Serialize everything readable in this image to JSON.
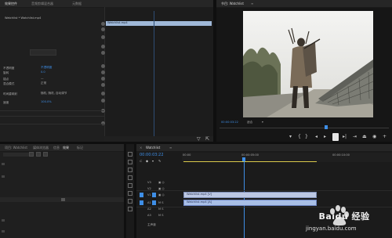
{
  "effect_controls": {
    "tabs": [
      "效果控件",
      "音频剪辑混合器",
      "元数据"
    ],
    "clip_title": "Watchlist * Watchlist.mp4",
    "seq_label": "Watchlist.mp4",
    "rows": [
      {
        "label": "不透明度",
        "value": "不透明度"
      },
      {
        "label": "旋转",
        "value": "0.0"
      },
      {
        "label": "锚点",
        "value": "—"
      },
      {
        "label": "混合模式",
        "value": "正常"
      },
      {
        "label": "时间重映射",
        "value": "随机, 随机, 自动调节"
      },
      {
        "label": "速度",
        "value": "100.0%"
      }
    ]
  },
  "program_monitor": {
    "tab_label": "节目: Watchlist",
    "timecode": "00:00:03:22",
    "fit_label": "适合"
  },
  "project": {
    "tabs": [
      "项目: Watchlist",
      "媒体浏览器",
      "信息",
      "效果",
      "标记"
    ]
  },
  "timeline": {
    "tab_label": "Watchlist",
    "timecode": "00:00:03:22",
    "ruler_labels": [
      "00:00",
      "00:00:05:00",
      "00:00:10:00"
    ],
    "tracks": [
      "V3",
      "V2",
      "V1",
      "A1",
      "A2",
      "A3"
    ],
    "clip_video": "Watchlist.mp4 [V]",
    "clip_audio": "Watchlist.mp4 [A]",
    "master_label": "主声道"
  },
  "watermark": {
    "text": "Baidu 经验",
    "url": "jingyan.baidu.com"
  }
}
